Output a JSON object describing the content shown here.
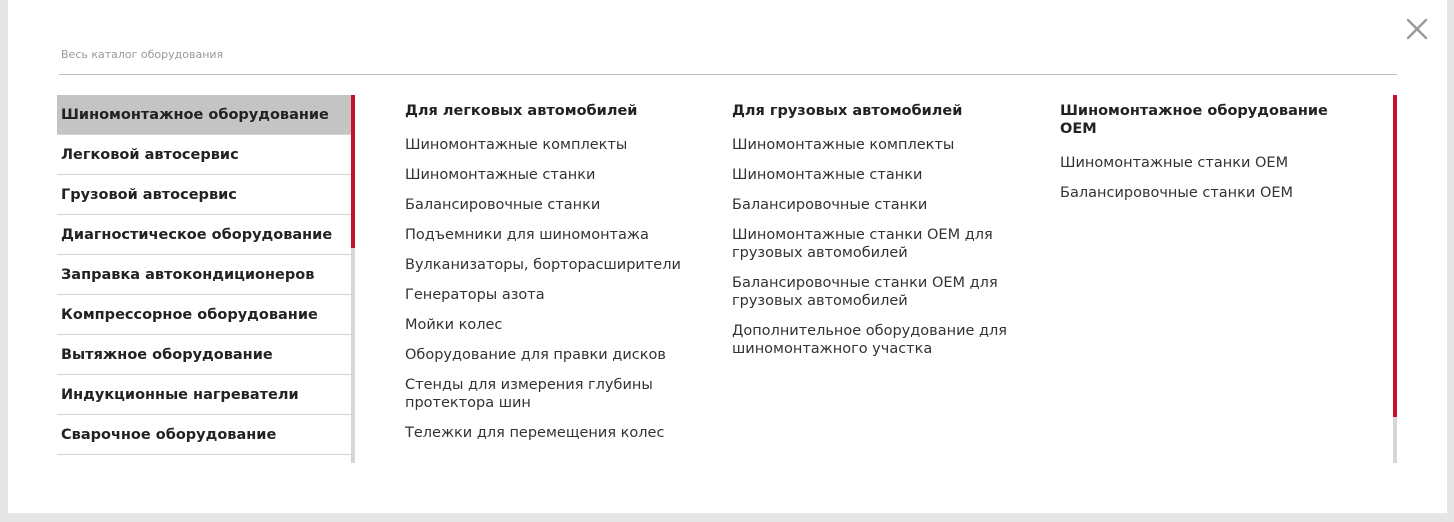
{
  "header": {
    "catalog_link": "Весь каталог оборудования",
    "close_icon": "close-icon"
  },
  "colors": {
    "accent": "#c8102e",
    "active_bg": "#c4c4c4",
    "divider": "#d4d4d4"
  },
  "categories": [
    {
      "label": "Шиномонтажное оборудование",
      "active": true
    },
    {
      "label": "Легковой автосервис"
    },
    {
      "label": "Грузовой автосервис"
    },
    {
      "label": "Диагностическое оборудование"
    },
    {
      "label": "Заправка автокондиционеров"
    },
    {
      "label": "Компрессорное оборудование"
    },
    {
      "label": "Вытяжное оборудование"
    },
    {
      "label": "Индукционные нагреватели"
    },
    {
      "label": "Сварочное оборудование"
    }
  ],
  "columns": [
    {
      "title": "Для легковых автомобилей",
      "links": [
        "Шиномонтажные комплекты",
        "Шиномонтажные станки",
        "Балансировочные станки",
        "Подъемники для шиномонтажа",
        "Вулканизаторы, борторасширители",
        "Генераторы азота",
        "Мойки колес",
        "Оборудование для правки дисков",
        "Стенды для измерения глубины протектора шин",
        "Тележки для перемещения колес"
      ]
    },
    {
      "title": "Для грузовых автомобилей",
      "links": [
        "Шиномонтажные комплекты",
        "Шиномонтажные станки",
        "Балансировочные станки",
        "Шиномонтажные станки OEM для грузовых автомобилей",
        "Балансировочные станки OEM для грузовых автомобилей",
        "Дополнительное оборудование для шиномонтажного участка"
      ]
    },
    {
      "title": "Шиномонтажное оборудование OEM",
      "links": [
        "Шиномонтажные станки OEM",
        "Балансировочные станки OEM"
      ]
    }
  ]
}
